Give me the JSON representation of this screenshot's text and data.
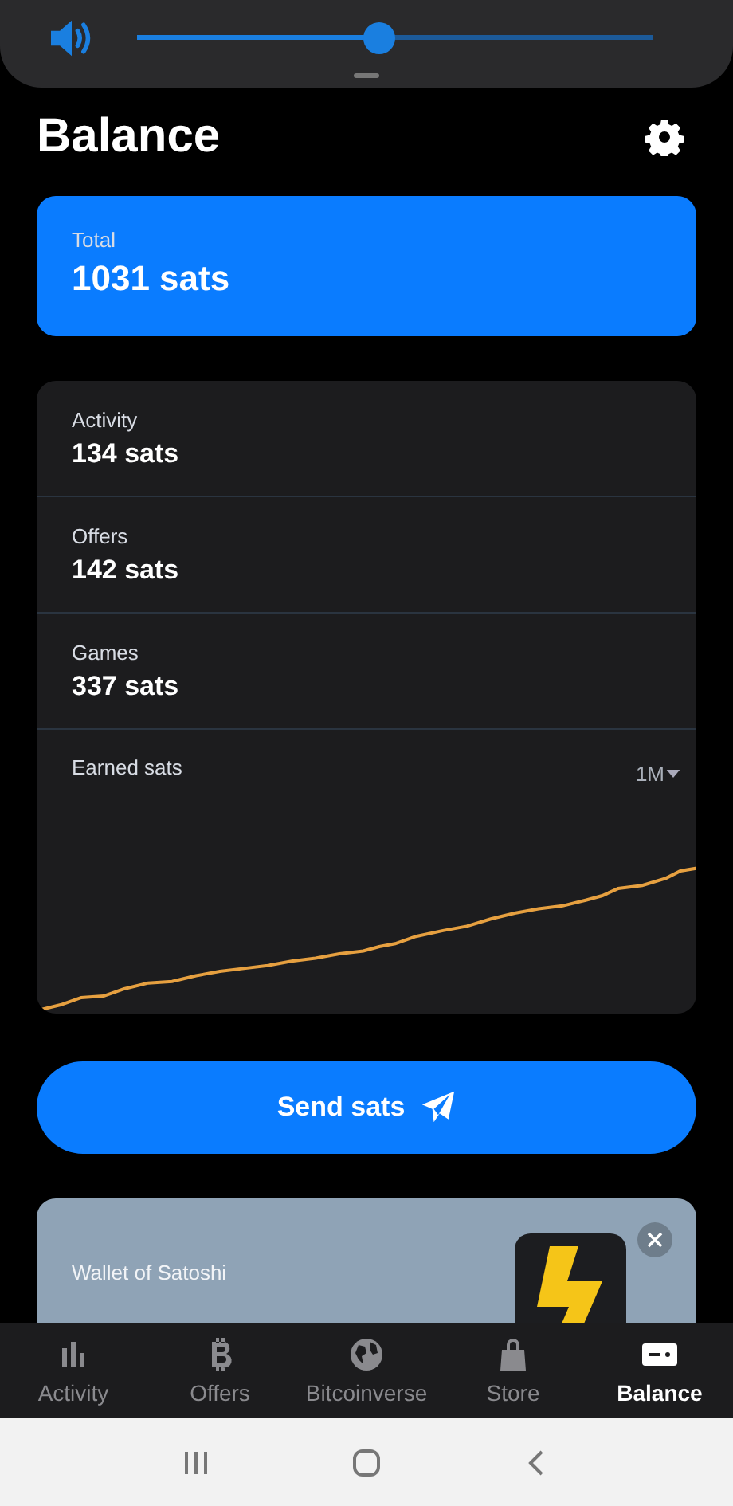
{
  "volume_panel": {
    "level": 0.47
  },
  "header": {
    "title": "Balance"
  },
  "total_card": {
    "label": "Total",
    "amount": "1031 sats"
  },
  "breakdown": [
    {
      "label": "Activity",
      "amount": "134 sats"
    },
    {
      "label": "Offers",
      "amount": "142 sats"
    },
    {
      "label": "Games",
      "amount": "337 sats"
    }
  ],
  "earnings_chart": {
    "title": "Earned sats",
    "period": "1M"
  },
  "send_button": {
    "label": "Send sats"
  },
  "promo_banner": {
    "brand": "Wallet of Satoshi"
  },
  "tab_bar": [
    {
      "label": "Activity",
      "kind": "bars",
      "selected": false
    },
    {
      "label": "Offers",
      "kind": "bitcoin",
      "selected": false
    },
    {
      "label": "Bitcoinverse",
      "kind": "globe",
      "selected": false
    },
    {
      "label": "Store",
      "kind": "bag",
      "selected": false
    },
    {
      "label": "Balance",
      "kind": "wallet",
      "selected": true
    }
  ]
}
